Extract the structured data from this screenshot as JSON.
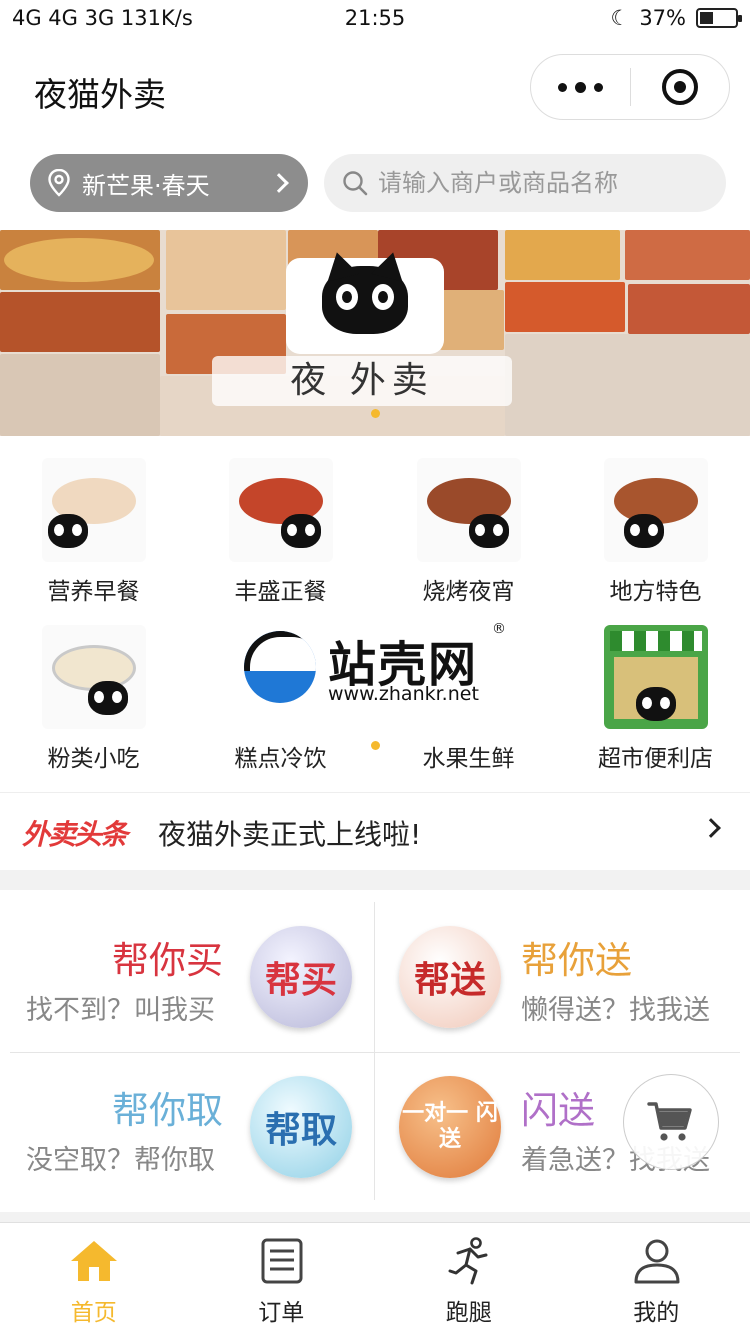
{
  "status_bar": {
    "network": "4G 4G 3G 131K/s",
    "time": "21:55",
    "battery": "37%"
  },
  "header": {
    "title": "夜猫外卖"
  },
  "location": {
    "label": "新芒果·春天"
  },
  "search": {
    "placeholder": "请输入商户或商品名称"
  },
  "banner": {
    "brand_text": "夜 外卖"
  },
  "categories": [
    {
      "label": "营养早餐",
      "icon": "breakfast-food-icon"
    },
    {
      "label": "丰盛正餐",
      "icon": "meal-food-icon"
    },
    {
      "label": "烧烤夜宵",
      "icon": "bbq-food-icon"
    },
    {
      "label": "地方特色",
      "icon": "local-food-icon"
    },
    {
      "label": "粉类小吃",
      "icon": "noodle-food-icon"
    },
    {
      "label": "糕点冷饮",
      "icon": "dessert-food-icon"
    },
    {
      "label": "水果生鲜",
      "icon": "fruit-food-icon"
    },
    {
      "label": "超市便利店",
      "icon": "supermarket-icon"
    }
  ],
  "watermark": {
    "cn": "站壳网",
    "en": "www.zhankr.net",
    "reg": "®"
  },
  "news": {
    "brand": "外卖头条",
    "text": "夜猫外卖正式上线啦!"
  },
  "services": [
    {
      "name": "帮你买",
      "sub": "找不到？叫我买",
      "badge": "帮买",
      "color": "#d8343f"
    },
    {
      "name": "帮你送",
      "sub": "懒得送？找我送",
      "badge": "帮送",
      "color": "#e8a13a"
    },
    {
      "name": "帮你取",
      "sub": "没空取？帮你取",
      "badge": "帮取",
      "color": "#6ab0d8"
    },
    {
      "name": "闪送",
      "sub": "着急送？找我送",
      "badge": "一对一 闪送",
      "color": "#b070c8"
    }
  ],
  "tabs": [
    {
      "label": "首页",
      "icon": "home-icon",
      "active": true
    },
    {
      "label": "订单",
      "icon": "order-list-icon",
      "active": false
    },
    {
      "label": "跑腿",
      "icon": "runner-icon",
      "active": false
    },
    {
      "label": "我的",
      "icon": "user-icon",
      "active": false
    }
  ],
  "colors": {
    "accent": "#f5b92e",
    "news_brand": "#e23a3a"
  }
}
